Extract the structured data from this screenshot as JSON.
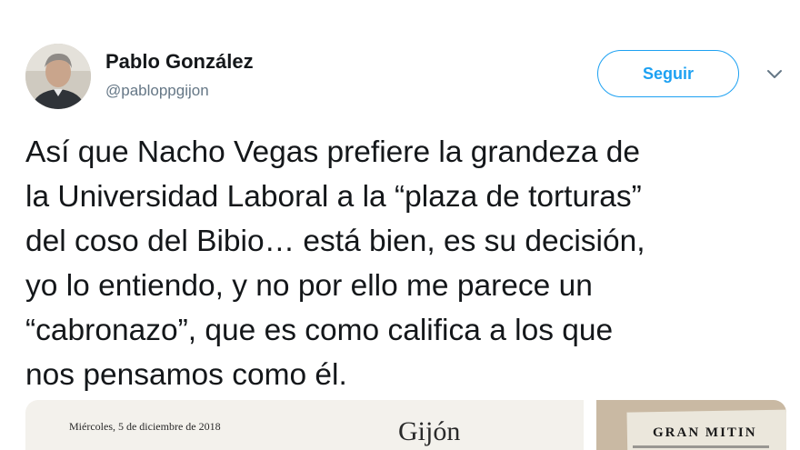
{
  "author": {
    "name": "Pablo González",
    "handle": "@pabloppgijon",
    "avatar_icon": "profile-photo"
  },
  "follow_button": {
    "label": "Seguir"
  },
  "menu_icon": "chevron-down-icon",
  "tweet": {
    "lines": [
      "Así que Nacho Vegas prefiere la grandeza de",
      "la Universidad Laboral a la “plaza de torturas”",
      "del coso del Bibio… está bien, es su decisión,",
      "yo lo entiendo, y no por ello me parece un",
      "“cabronazo”, que es como califica a los que",
      "nos pensamos como él."
    ]
  },
  "media": {
    "newspaper_date": "Miércoles, 5 de diciembre de 2018",
    "newspaper_city": "Gijón",
    "poster_title": "GRAN MITIN"
  },
  "colors": {
    "accent": "#1da1f2",
    "text": "#14171a",
    "secondary_text": "#657786"
  }
}
